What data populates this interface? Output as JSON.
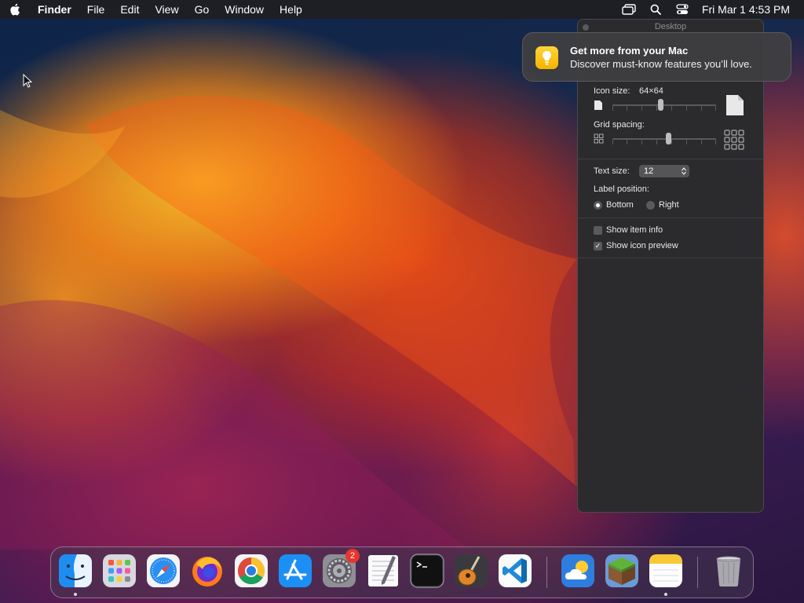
{
  "menubar": {
    "apple_icon": "apple-logo-icon",
    "app_name": "Finder",
    "menus": [
      "File",
      "Edit",
      "View",
      "Go",
      "Window",
      "Help"
    ],
    "status_icons": [
      "screen-mirroring-icon",
      "spotlight-search-icon",
      "control-center-icon"
    ],
    "clock": "Fri Mar 1  4:53 PM"
  },
  "view_options": {
    "title": "Desktop",
    "icon_size_label": "Icon size:",
    "icon_size_value": "64×64",
    "icon_size_level": 0.46,
    "grid_spacing_label": "Grid spacing:",
    "grid_spacing_level": 0.54,
    "text_size_label": "Text size:",
    "text_size_value": "12",
    "label_position_label": "Label position:",
    "label_position_options": [
      "Bottom",
      "Right"
    ],
    "label_position_selected": "Bottom",
    "show_item_info_label": "Show item info",
    "show_item_info": false,
    "show_icon_preview_label": "Show icon preview",
    "show_icon_preview": true
  },
  "notification": {
    "icon": "tips-lightbulb-icon",
    "title": "Get more from your Mac",
    "body": "Discover must-know features you’ll love."
  },
  "dock": {
    "apps": [
      {
        "name": "Finder",
        "icon": "finder-icon",
        "running": true
      },
      {
        "name": "Launchpad",
        "icon": "launchpad-icon",
        "running": false
      },
      {
        "name": "Safari",
        "icon": "safari-icon",
        "running": false
      },
      {
        "name": "Firefox",
        "icon": "firefox-icon",
        "running": false
      },
      {
        "name": "Chrome",
        "icon": "chrome-icon",
        "running": false
      },
      {
        "name": "App Store",
        "icon": "app-store-icon",
        "running": false
      },
      {
        "name": "System Settings",
        "icon": "system-settings-icon",
        "running": false,
        "badge": "2"
      },
      {
        "name": "TextEdit",
        "icon": "textedit-icon",
        "running": false
      },
      {
        "name": "Terminal",
        "icon": "terminal-icon",
        "running": false
      },
      {
        "name": "GarageBand",
        "icon": "garageband-icon",
        "running": false
      },
      {
        "name": "Visual Studio Code",
        "icon": "vscode-icon",
        "running": false
      },
      {
        "name": "Weather",
        "icon": "weather-icon",
        "running": false
      },
      {
        "name": "Minecraft",
        "icon": "minecraft-icon",
        "running": false
      },
      {
        "name": "Notes",
        "icon": "notes-icon",
        "running": true
      },
      {
        "name": "Trash",
        "icon": "trash-icon",
        "running": false
      }
    ]
  },
  "colors": {
    "accent_badge": "#e8352b",
    "panel_bg": "#2b2b2d",
    "menubar_bg": "#1e1e22"
  }
}
